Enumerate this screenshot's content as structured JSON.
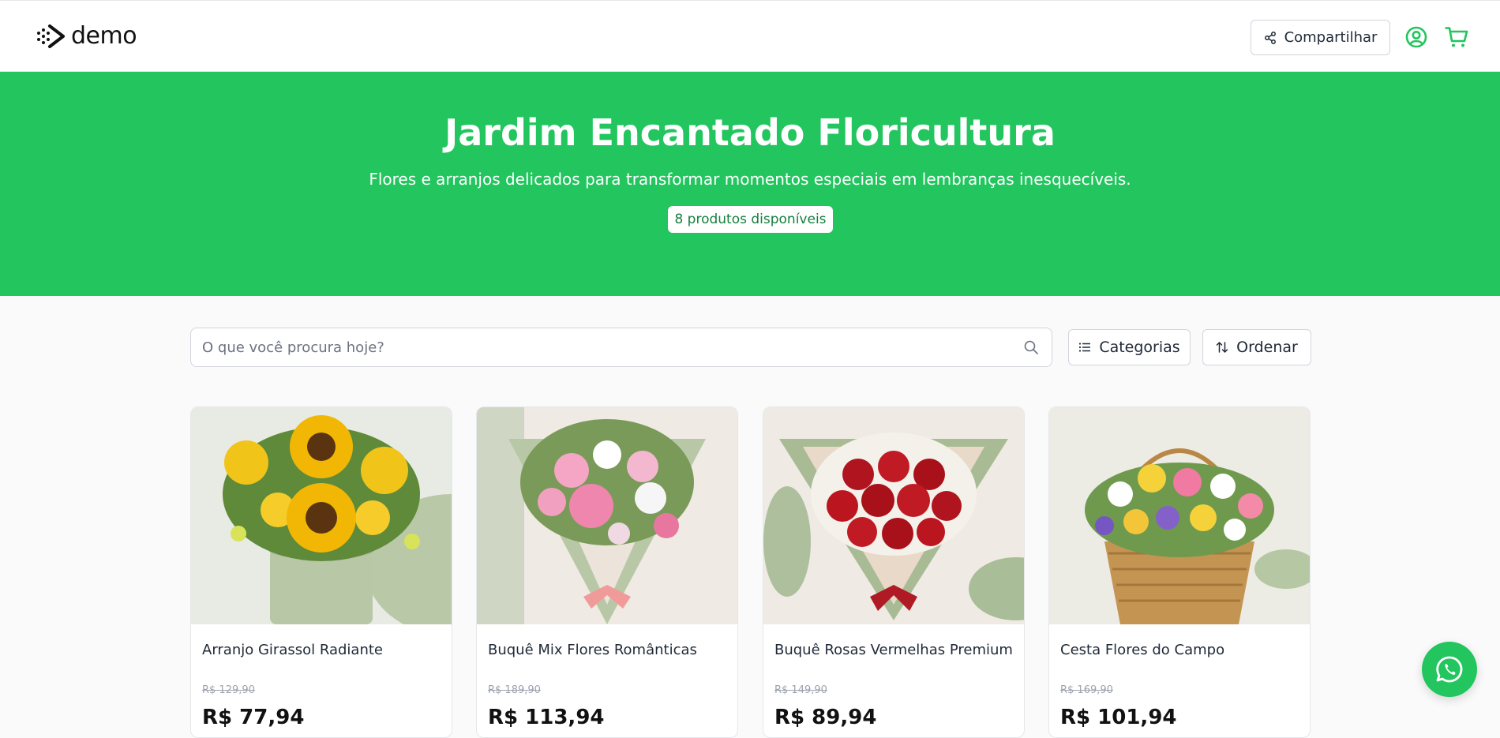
{
  "header": {
    "logo_text": "demo",
    "share_label": "Compartilhar",
    "accent_color": "#22c55e"
  },
  "hero": {
    "title": "Jardim Encantado Floricultura",
    "subtitle": "Flores e arranjos delicados para transformar momentos especiais em lembranças inesquecíveis.",
    "badge": "8 produtos disponíveis"
  },
  "search": {
    "placeholder": "O que você procura hoje?",
    "value": ""
  },
  "filters": {
    "categories_label": "Categorias",
    "sort_label": "Ordenar"
  },
  "products": [
    {
      "name": "Arranjo Girassol Radiante",
      "old_price": "R$ 129,90",
      "price": "R$ 77,94",
      "image": "sunflower-arrangement"
    },
    {
      "name": "Buquê Mix Flores Românticas",
      "old_price": "R$ 189,90",
      "price": "R$ 113,94",
      "image": "pink-mixed-bouquet"
    },
    {
      "name": "Buquê Rosas Vermelhas Premium",
      "old_price": "R$ 149,90",
      "price": "R$ 89,94",
      "image": "red-roses-bouquet"
    },
    {
      "name": "Cesta Flores do Campo",
      "old_price": "R$ 169,90",
      "price": "R$ 101,94",
      "image": "wildflower-basket"
    }
  ],
  "floating": {
    "icon": "whatsapp-icon"
  }
}
